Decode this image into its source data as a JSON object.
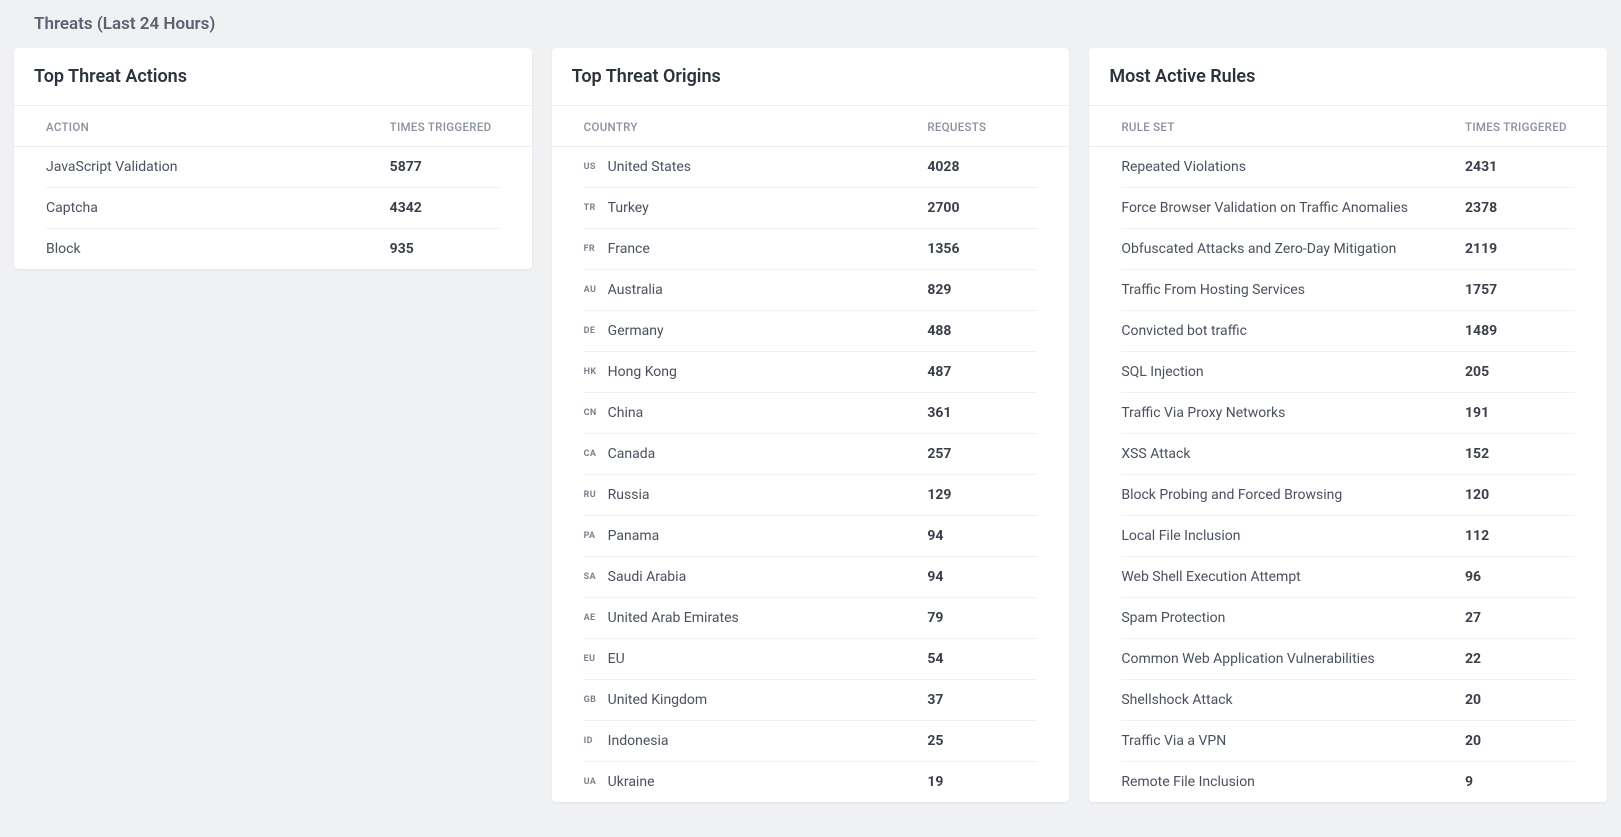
{
  "page": {
    "title": "Threats (Last 24 Hours)"
  },
  "cards": {
    "actions": {
      "title": "Top Threat Actions",
      "col1": "ACTION",
      "col2": "TIMES TRIGGERED",
      "rows": [
        {
          "label": "JavaScript Validation",
          "value": "5877"
        },
        {
          "label": "Captcha",
          "value": "4342"
        },
        {
          "label": "Block",
          "value": "935"
        }
      ]
    },
    "origins": {
      "title": "Top Threat Origins",
      "col1": "COUNTRY",
      "col2": "REQUESTS",
      "rows": [
        {
          "code": "US",
          "label": "United States",
          "value": "4028"
        },
        {
          "code": "TR",
          "label": "Turkey",
          "value": "2700"
        },
        {
          "code": "FR",
          "label": "France",
          "value": "1356"
        },
        {
          "code": "AU",
          "label": "Australia",
          "value": "829"
        },
        {
          "code": "DE",
          "label": "Germany",
          "value": "488"
        },
        {
          "code": "HK",
          "label": "Hong Kong",
          "value": "487"
        },
        {
          "code": "CN",
          "label": "China",
          "value": "361"
        },
        {
          "code": "CA",
          "label": "Canada",
          "value": "257"
        },
        {
          "code": "RU",
          "label": "Russia",
          "value": "129"
        },
        {
          "code": "PA",
          "label": "Panama",
          "value": "94"
        },
        {
          "code": "SA",
          "label": "Saudi Arabia",
          "value": "94"
        },
        {
          "code": "AE",
          "label": "United Arab Emirates",
          "value": "79"
        },
        {
          "code": "EU",
          "label": "EU",
          "value": "54"
        },
        {
          "code": "GB",
          "label": "United Kingdom",
          "value": "37"
        },
        {
          "code": "ID",
          "label": "Indonesia",
          "value": "25"
        },
        {
          "code": "UA",
          "label": "Ukraine",
          "value": "19"
        }
      ]
    },
    "rules": {
      "title": "Most Active Rules",
      "col1": "RULE SET",
      "col2": "TIMES TRIGGERED",
      "rows": [
        {
          "label": "Repeated Violations",
          "value": "2431"
        },
        {
          "label": "Force Browser Validation on Traffic Anomalies",
          "value": "2378"
        },
        {
          "label": "Obfuscated Attacks and Zero-Day Mitigation",
          "value": "2119"
        },
        {
          "label": "Traffic From Hosting Services",
          "value": "1757"
        },
        {
          "label": "Convicted bot traffic",
          "value": "1489"
        },
        {
          "label": "SQL Injection",
          "value": "205"
        },
        {
          "label": "Traffic Via Proxy Networks",
          "value": "191"
        },
        {
          "label": "XSS Attack",
          "value": "152"
        },
        {
          "label": "Block Probing and Forced Browsing",
          "value": "120"
        },
        {
          "label": "Local File Inclusion",
          "value": "112"
        },
        {
          "label": "Web Shell Execution Attempt",
          "value": "96"
        },
        {
          "label": "Spam Protection",
          "value": "27"
        },
        {
          "label": "Common Web Application Vulnerabilities",
          "value": "22"
        },
        {
          "label": "Shellshock Attack",
          "value": "20"
        },
        {
          "label": "Traffic Via a VPN",
          "value": "20"
        },
        {
          "label": "Remote File Inclusion",
          "value": "9"
        }
      ]
    }
  }
}
